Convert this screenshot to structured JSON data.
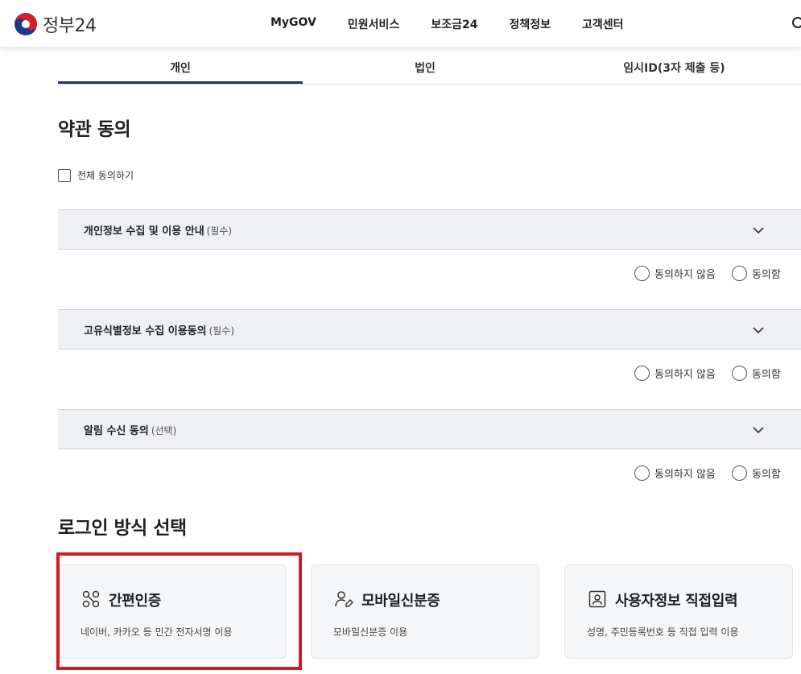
{
  "header": {
    "logo_text": "정부24",
    "nav": [
      "MyGOV",
      "민원서비스",
      "보조금24",
      "정책정보",
      "고객센터"
    ]
  },
  "tabs": [
    {
      "label": "개인",
      "selected": true
    },
    {
      "label": "법인",
      "selected": false
    },
    {
      "label": "임시ID(3자 제출 등)",
      "selected": false
    }
  ],
  "terms": {
    "title": "약관 동의",
    "agree_all_label": "전체 동의하기",
    "items": [
      {
        "title": "개인정보 수집 및 이용 안내",
        "note": "(필수)"
      },
      {
        "title": "고유식별정보 수집 이용동의",
        "note": "(필수)"
      },
      {
        "title": "알림 수신 동의",
        "note": "(선택)"
      }
    ],
    "disagree_label": "동의하지 않음",
    "agree_label": "동의함"
  },
  "login": {
    "title": "로그인 방식 선택",
    "methods": [
      {
        "title": "간편인증",
        "desc": "네이버, 카카오 등 민간 전자서명 이용",
        "icon": "simple-auth-icon"
      },
      {
        "title": "모바일신분증",
        "desc": "모바일신분증 이용",
        "icon": "mobile-id-icon"
      },
      {
        "title": "사용자정보 직접입력",
        "desc": "성명, 주민등록번호 등 직접 입력 이용",
        "icon": "user-info-icon"
      }
    ],
    "highlight_color": "#d9181f"
  }
}
